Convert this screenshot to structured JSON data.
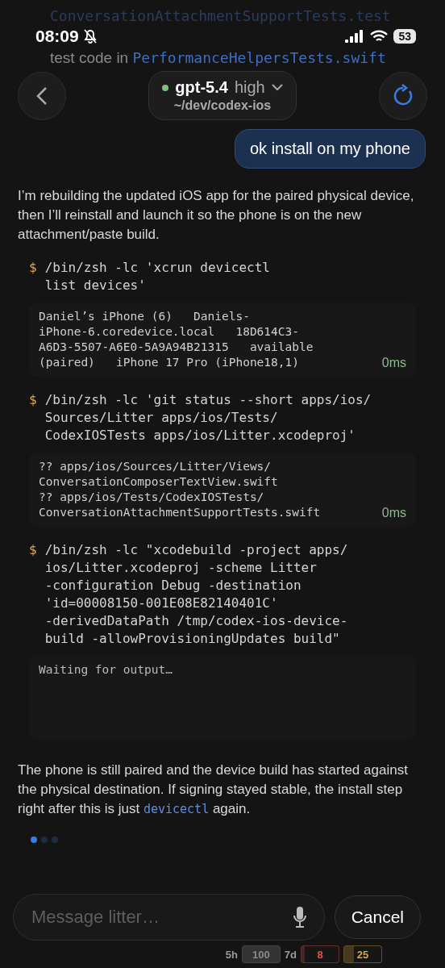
{
  "status_bar": {
    "time": "08:09",
    "silent": true,
    "battery": "53"
  },
  "scrolled_text": [
    {
      "kind": "code",
      "text": "ConversationAttachmentSupportTests.test"
    },
    {
      "kind": "mixed",
      "parts": [
        {
          "kind": "prose",
          "text": "test code in "
        },
        {
          "kind": "code",
          "text": "PerformanceHelpersTests.swift"
        }
      ]
    }
  ],
  "header": {
    "model": "gpt-5.4",
    "effort": "high",
    "path": "~/dev/codex-ios",
    "connected": true
  },
  "user_message": "ok install on my phone",
  "intro": "I’m rebuilding the updated iOS app for the paired physical device, then I’ll reinstall and launch it so the phone is on the new attachment/paste build.",
  "commands": [
    {
      "prompt": "$",
      "command": "/bin/zsh -lc 'xcrun devicectl\nlist devices'",
      "output": "Daniel’s iPhone (6)   Daniels-\niPhone-6.coredevice.local   18D614C3-\nA6D3-5507-A6E0-5A9A94B21315   available\n(paired)   iPhone 17 Pro (iPhone18,1)",
      "duration": "0ms",
      "running": false
    },
    {
      "prompt": "$",
      "command": "/bin/zsh -lc 'git status --short apps/ios/\nSources/Litter apps/ios/Tests/\nCodexIOSTests apps/ios/Litter.xcodeproj'",
      "output": "?? apps/ios/Sources/Litter/Views/\nConversationComposerTextView.swift\n?? apps/ios/Tests/CodexIOSTests/\nConversationAttachmentSupportTests.swift",
      "duration": "0ms",
      "running": false
    },
    {
      "prompt": "$",
      "command": "/bin/zsh -lc \"xcodebuild -project apps/\nios/Litter.xcodeproj -scheme Litter\n-configuration Debug -destination\n'id=00008150-001E08E82140401C'\n-derivedDataPath /tmp/codex-ios-device-\nbuild -allowProvisioningUpdates build\"",
      "output": "Waiting for output…",
      "running": true
    }
  ],
  "summary": [
    {
      "kind": "prose",
      "text": "The phone is still paired and the device build has started against the physical destination. If signing stayed stable, the install step right after this is just "
    },
    {
      "kind": "code",
      "text": "devicectl"
    },
    {
      "kind": "prose",
      "text": " again."
    }
  ],
  "page_dots": [
    {
      "selected": true
    },
    {
      "selected": false
    },
    {
      "selected": false
    }
  ],
  "composer": {
    "placeholder": "Message litter…",
    "button": "Cancel"
  },
  "usage": [
    {
      "label": "5h",
      "value": "100",
      "level": 1,
      "color": "#8a8a8a"
    },
    {
      "label": "7d",
      "value": "8",
      "level": 0.08,
      "color": "#e0524f"
    },
    {
      "value": "25",
      "level": 0.25,
      "color": "#d9a441"
    }
  ]
}
